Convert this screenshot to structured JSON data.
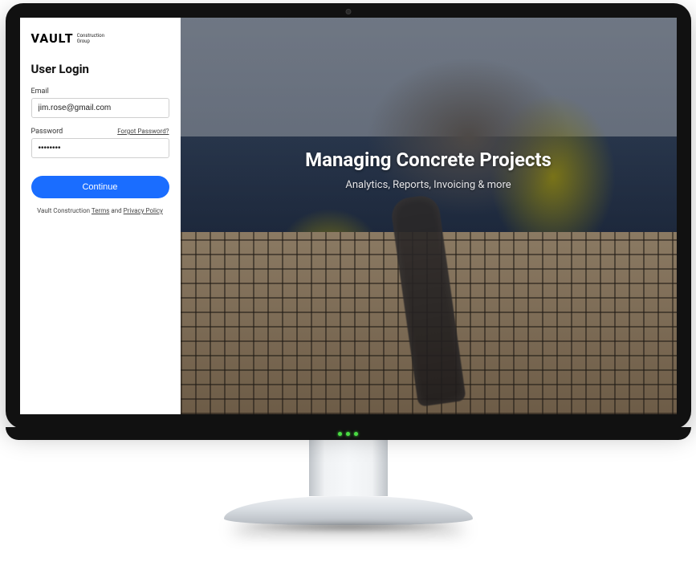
{
  "brand": {
    "name": "VAULT",
    "subtitle_line1": "Construction",
    "subtitle_line2": "Group"
  },
  "login": {
    "heading": "User Login",
    "email_label": "Email",
    "email_value": "jim.rose@gmail.com",
    "password_label": "Password",
    "password_value": "••••••••",
    "forgot_label": "Forgot Password?",
    "submit_label": "Continue"
  },
  "legal": {
    "prefix": "Vault Construction ",
    "terms_label": "Terms",
    "connector": " and ",
    "privacy_label": "Privacy Policy"
  },
  "hero": {
    "title": "Managing Concrete Projects",
    "subtitle": "Analytics, Reports, Invoicing & more"
  },
  "colors": {
    "primary": "#1a6dff"
  }
}
